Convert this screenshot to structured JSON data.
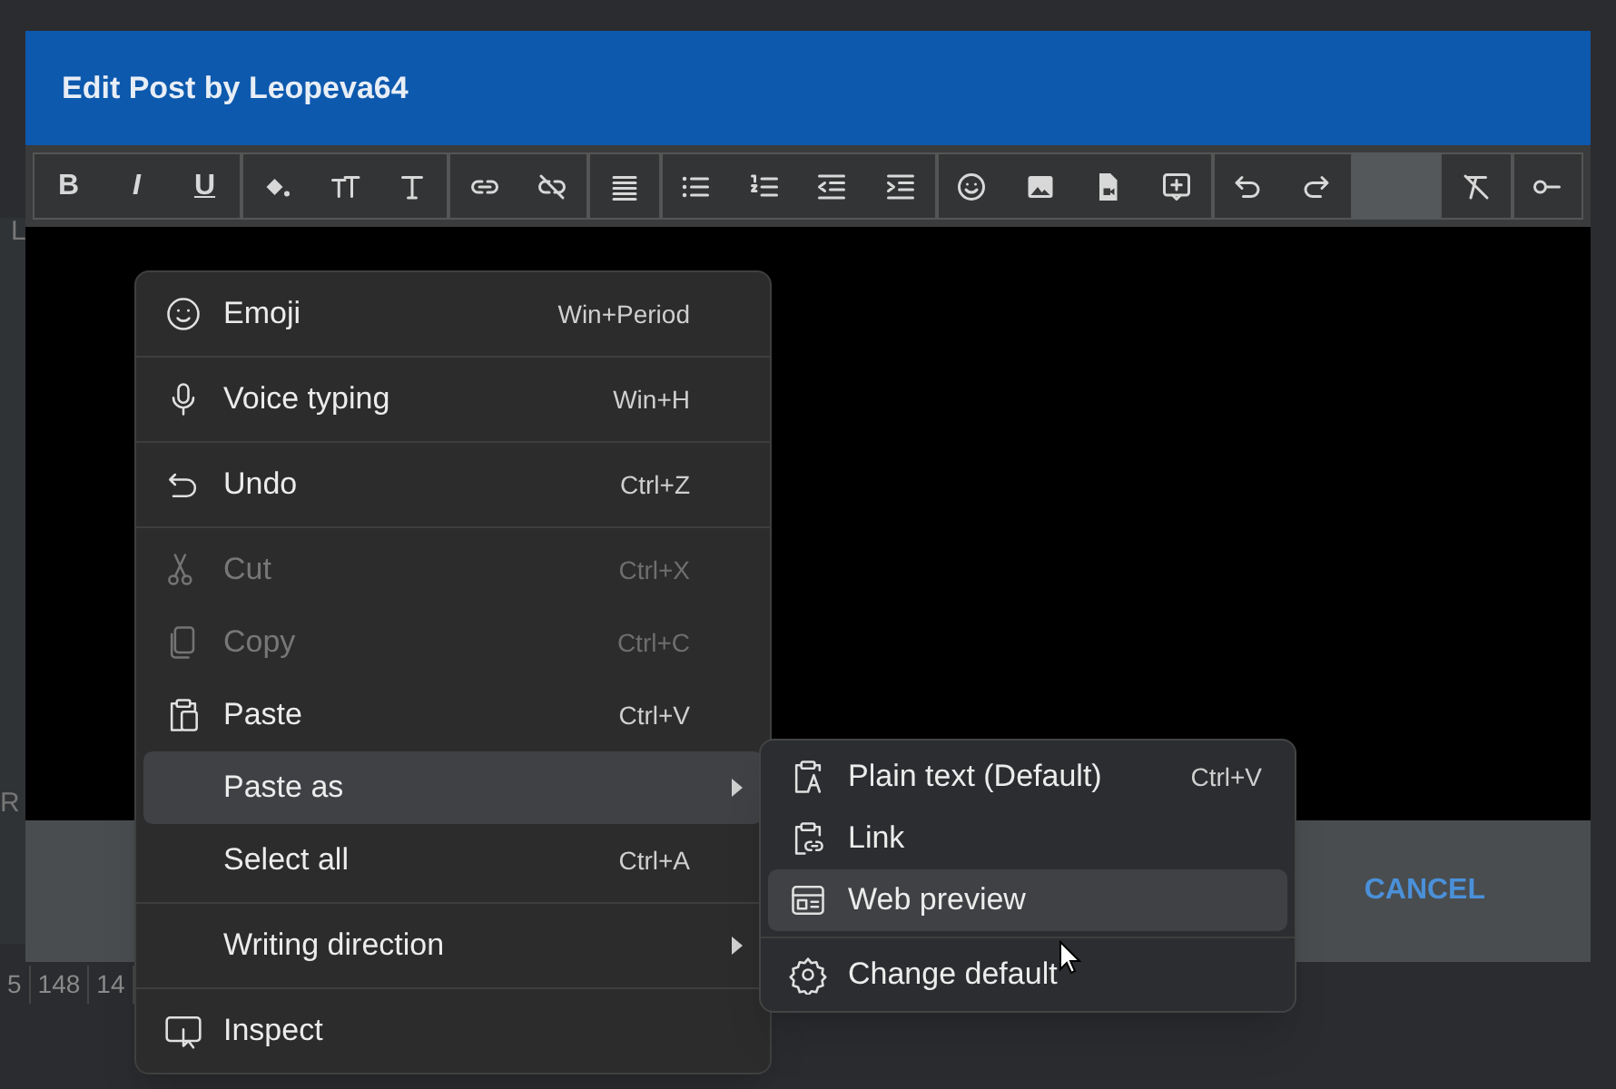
{
  "background_fragments": {
    "left_letter": "L",
    "left_row": "R",
    "bottom_cells": [
      "5",
      "148",
      "14"
    ]
  },
  "dialog": {
    "title": "Edit Post by Leopeva64",
    "toolbar": {
      "text_buttons": [
        "B",
        "I",
        "U"
      ]
    },
    "cancel_button": "CANCEL"
  },
  "context_menu": {
    "items": [
      {
        "kind": "item",
        "label": "Emoji",
        "shortcut": "Win+Period",
        "disabled": false,
        "selected": false
      },
      {
        "kind": "separator"
      },
      {
        "kind": "item",
        "label": "Voice typing",
        "shortcut": "Win+H",
        "disabled": false,
        "selected": false
      },
      {
        "kind": "separator"
      },
      {
        "kind": "item",
        "label": "Undo",
        "shortcut": "Ctrl+Z",
        "disabled": false,
        "selected": false
      },
      {
        "kind": "separator"
      },
      {
        "kind": "item",
        "label": "Cut",
        "shortcut": "Ctrl+X",
        "disabled": true,
        "selected": false
      },
      {
        "kind": "item",
        "label": "Copy",
        "shortcut": "Ctrl+C",
        "disabled": true,
        "selected": false
      },
      {
        "kind": "item",
        "label": "Paste",
        "shortcut": "Ctrl+V",
        "disabled": false,
        "selected": false
      },
      {
        "kind": "submenu",
        "label": "Paste as",
        "disabled": false,
        "selected": true
      },
      {
        "kind": "item",
        "label": "Select all",
        "shortcut": "Ctrl+A",
        "disabled": false,
        "selected": false
      },
      {
        "kind": "separator"
      },
      {
        "kind": "submenu",
        "label": "Writing direction",
        "disabled": false,
        "selected": false
      },
      {
        "kind": "separator"
      },
      {
        "kind": "item",
        "label": "Inspect",
        "disabled": false,
        "selected": false
      }
    ]
  },
  "submenu": {
    "items": [
      {
        "kind": "item",
        "label": "Plain text (Default)",
        "shortcut": "Ctrl+V",
        "selected": false
      },
      {
        "kind": "item",
        "label": "Link",
        "selected": false
      },
      {
        "kind": "item",
        "label": "Web preview",
        "selected": true
      },
      {
        "kind": "separator"
      },
      {
        "kind": "item",
        "label": "Change default",
        "selected": false
      }
    ]
  }
}
